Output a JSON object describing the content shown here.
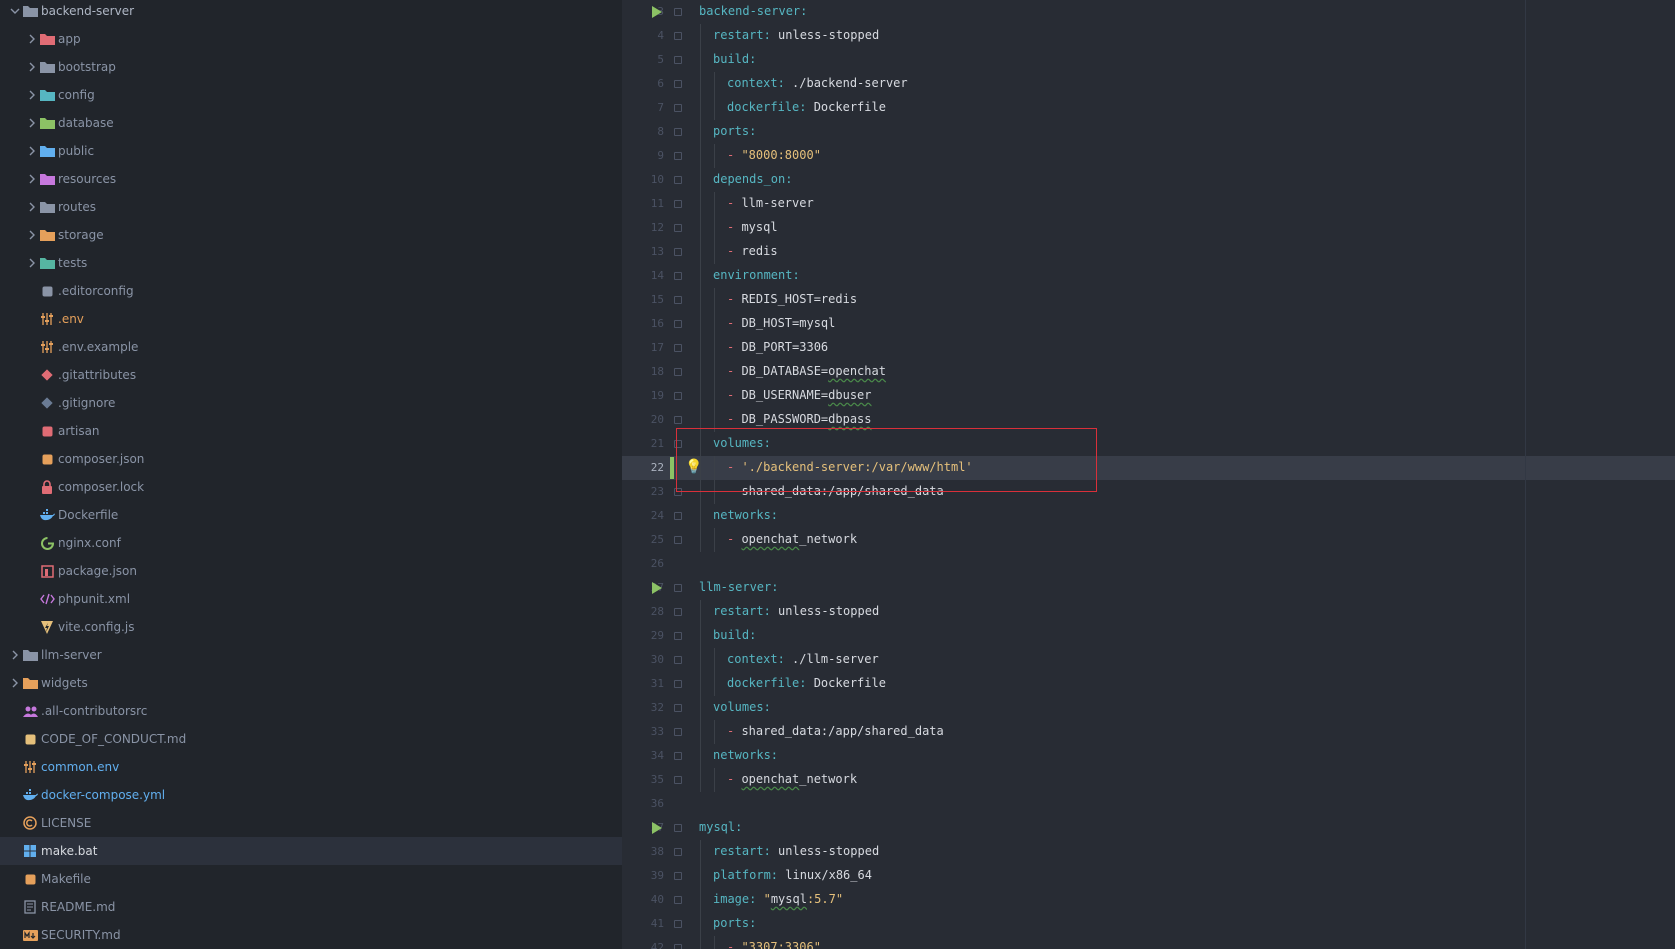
{
  "project_tree": {
    "items": [
      {
        "label": "backend-server",
        "depth": 0,
        "expanded": true,
        "icon": "folder-icon",
        "color": "#8a94a6",
        "style": "hl"
      },
      {
        "label": "app",
        "depth": 1,
        "expanded": false,
        "icon": "folder-app-icon",
        "color": "#e06c75"
      },
      {
        "label": "bootstrap",
        "depth": 1,
        "expanded": false,
        "icon": "folder-icon",
        "color": "#8a94a6"
      },
      {
        "label": "config",
        "depth": 1,
        "expanded": false,
        "icon": "folder-config-icon",
        "color": "#56b6c2"
      },
      {
        "label": "database",
        "depth": 1,
        "expanded": false,
        "icon": "folder-database-icon",
        "color": "#8cc265"
      },
      {
        "label": "public",
        "depth": 1,
        "expanded": false,
        "icon": "folder-public-icon",
        "color": "#61afef"
      },
      {
        "label": "resources",
        "depth": 1,
        "expanded": false,
        "icon": "folder-resources-icon",
        "color": "#c678dd"
      },
      {
        "label": "routes",
        "depth": 1,
        "expanded": false,
        "icon": "folder-routes-icon",
        "color": "#8a94a6"
      },
      {
        "label": "storage",
        "depth": 1,
        "expanded": false,
        "icon": "folder-storage-icon",
        "color": "#e5a05b"
      },
      {
        "label": "tests",
        "depth": 1,
        "expanded": false,
        "icon": "folder-tests-icon",
        "color": "#56b6a2"
      },
      {
        "label": ".editorconfig",
        "depth": 1,
        "icon": "editorconfig-icon",
        "color": "#8a94a6"
      },
      {
        "label": ".env",
        "depth": 1,
        "icon": "env-icon",
        "color": "#e5a05b",
        "style": "env"
      },
      {
        "label": ".env.example",
        "depth": 1,
        "icon": "env-icon",
        "color": "#e5a05b"
      },
      {
        "label": ".gitattributes",
        "depth": 1,
        "icon": "git-icon",
        "color": "#e06c75"
      },
      {
        "label": ".gitignore",
        "depth": 1,
        "icon": "git-icon",
        "color": "#6a7b94"
      },
      {
        "label": "artisan",
        "depth": 1,
        "icon": "laravel-icon",
        "color": "#e06c75"
      },
      {
        "label": "composer.json",
        "depth": 1,
        "icon": "composer-icon",
        "color": "#e5a05b"
      },
      {
        "label": "composer.lock",
        "depth": 1,
        "icon": "lock-icon",
        "color": "#e06c75"
      },
      {
        "label": "Dockerfile",
        "depth": 1,
        "icon": "docker-icon",
        "color": "#61afef"
      },
      {
        "label": "nginx.conf",
        "depth": 1,
        "icon": "nginx-icon",
        "color": "#8cc265"
      },
      {
        "label": "package.json",
        "depth": 1,
        "icon": "npm-icon",
        "color": "#e06c75"
      },
      {
        "label": "phpunit.xml",
        "depth": 1,
        "icon": "xml-icon",
        "color": "#c678dd"
      },
      {
        "label": "vite.config.js",
        "depth": 1,
        "icon": "vite-icon",
        "color": "#e5c07b"
      },
      {
        "label": "llm-server",
        "depth": 0,
        "expanded": false,
        "icon": "folder-icon",
        "color": "#8a94a6"
      },
      {
        "label": "widgets",
        "depth": 0,
        "expanded": false,
        "icon": "folder-widgets-icon",
        "color": "#e5a05b"
      },
      {
        "label": ".all-contributorsrc",
        "depth": 0,
        "icon": "contributors-icon",
        "color": "#c678dd"
      },
      {
        "label": "CODE_OF_CONDUCT.md",
        "depth": 0,
        "icon": "conduct-icon",
        "color": "#e5c07b"
      },
      {
        "label": "common.env",
        "depth": 0,
        "icon": "env-icon",
        "color": "#e5a05b",
        "style": "mod"
      },
      {
        "label": "docker-compose.yml",
        "depth": 0,
        "icon": "docker-icon",
        "color": "#61afef",
        "style": "mod"
      },
      {
        "label": "LICENSE",
        "depth": 0,
        "icon": "license-icon",
        "color": "#e5a05b"
      },
      {
        "label": "make.bat",
        "depth": 0,
        "icon": "windows-icon",
        "color": "#61afef",
        "style": "cur",
        "selected": true
      },
      {
        "label": "Makefile",
        "depth": 0,
        "icon": "makefile-icon",
        "color": "#e5a05b"
      },
      {
        "label": "README.md",
        "depth": 0,
        "icon": "readme-icon",
        "color": "#8a94a6"
      },
      {
        "label": "SECURITY.md",
        "depth": 0,
        "icon": "markdown-icon",
        "color": "#e5a05b"
      }
    ]
  },
  "editor": {
    "active_line": 22,
    "lines": [
      {
        "n": "3",
        "indent": 0,
        "run": true,
        "t": [
          [
            "backend-server",
            "k"
          ],
          [
            ":",
            "k"
          ]
        ]
      },
      {
        "n": "4",
        "indent": 1,
        "t": [
          [
            "restart",
            "k"
          ],
          [
            ": ",
            "k"
          ],
          [
            "unless-stopped",
            ""
          ]
        ]
      },
      {
        "n": "5",
        "indent": 1,
        "t": [
          [
            "build",
            "k"
          ],
          [
            ":",
            "k"
          ]
        ]
      },
      {
        "n": "6",
        "indent": 2,
        "t": [
          [
            "context",
            "k"
          ],
          [
            ": ",
            "k"
          ],
          [
            "./backend-server",
            ""
          ]
        ]
      },
      {
        "n": "7",
        "indent": 2,
        "t": [
          [
            "dockerfile",
            "k"
          ],
          [
            ": ",
            "k"
          ],
          [
            "Dockerfile",
            ""
          ]
        ]
      },
      {
        "n": "8",
        "indent": 1,
        "t": [
          [
            "ports",
            "k"
          ],
          [
            ":",
            "k"
          ]
        ]
      },
      {
        "n": "9",
        "indent": 2,
        "t": [
          [
            "- ",
            "d"
          ],
          [
            "\"8000:8000\"",
            "s2"
          ]
        ]
      },
      {
        "n": "10",
        "indent": 1,
        "t": [
          [
            "depends_on",
            "k"
          ],
          [
            ":",
            "k"
          ]
        ]
      },
      {
        "n": "11",
        "indent": 2,
        "t": [
          [
            "- ",
            "d"
          ],
          [
            "llm-server",
            ""
          ]
        ]
      },
      {
        "n": "12",
        "indent": 2,
        "t": [
          [
            "- ",
            "d"
          ],
          [
            "mysql",
            ""
          ]
        ]
      },
      {
        "n": "13",
        "indent": 2,
        "t": [
          [
            "- ",
            "d"
          ],
          [
            "redis",
            ""
          ]
        ]
      },
      {
        "n": "14",
        "indent": 1,
        "t": [
          [
            "environment",
            "k"
          ],
          [
            ":",
            "k"
          ]
        ]
      },
      {
        "n": "15",
        "indent": 2,
        "t": [
          [
            "- ",
            "d"
          ],
          [
            "REDIS_HOST=redis",
            ""
          ]
        ]
      },
      {
        "n": "16",
        "indent": 2,
        "t": [
          [
            "- ",
            "d"
          ],
          [
            "DB_HOST=mysql",
            ""
          ]
        ]
      },
      {
        "n": "17",
        "indent": 2,
        "t": [
          [
            "- ",
            "d"
          ],
          [
            "DB_PORT=3306",
            ""
          ]
        ]
      },
      {
        "n": "18",
        "indent": 2,
        "t": [
          [
            "- ",
            "d"
          ],
          [
            "DB_DATABASE=",
            ""
          ],
          [
            "openchat",
            "sq"
          ]
        ]
      },
      {
        "n": "19",
        "indent": 2,
        "t": [
          [
            "- ",
            "d"
          ],
          [
            "DB_USERNAME=",
            ""
          ],
          [
            "dbuser",
            "sq"
          ]
        ]
      },
      {
        "n": "20",
        "indent": 2,
        "t": [
          [
            "- ",
            "d"
          ],
          [
            "DB_PASSWORD=",
            ""
          ],
          [
            "dbpass",
            "sq"
          ]
        ]
      },
      {
        "n": "21",
        "indent": 1,
        "t": [
          [
            "volumes",
            "k"
          ],
          [
            ":",
            "k"
          ]
        ]
      },
      {
        "n": "22",
        "indent": 2,
        "active": true,
        "bulb": true,
        "mark": true,
        "t": [
          [
            "- ",
            "d"
          ],
          [
            "'./backend-server:/var/www/html'",
            "s2"
          ]
        ]
      },
      {
        "n": "23",
        "indent": 2,
        "t": [
          [
            "- ",
            "d"
          ],
          [
            "shared_data:/app/shared_data",
            ""
          ]
        ]
      },
      {
        "n": "24",
        "indent": 1,
        "t": [
          [
            "networks",
            "k"
          ],
          [
            ":",
            "k"
          ]
        ]
      },
      {
        "n": "25",
        "indent": 2,
        "t": [
          [
            "- ",
            "d"
          ],
          [
            "openchat",
            "sq"
          ],
          [
            "_network",
            ""
          ]
        ]
      },
      {
        "n": "26",
        "indent": 0,
        "t": []
      },
      {
        "n": "27",
        "indent": 0,
        "run": true,
        "t": [
          [
            "llm-server",
            "k"
          ],
          [
            ":",
            "k"
          ]
        ]
      },
      {
        "n": "28",
        "indent": 1,
        "t": [
          [
            "restart",
            "k"
          ],
          [
            ": ",
            "k"
          ],
          [
            "unless-stopped",
            ""
          ]
        ]
      },
      {
        "n": "29",
        "indent": 1,
        "t": [
          [
            "build",
            "k"
          ],
          [
            ":",
            "k"
          ]
        ]
      },
      {
        "n": "30",
        "indent": 2,
        "t": [
          [
            "context",
            "k"
          ],
          [
            ": ",
            "k"
          ],
          [
            "./llm-server",
            ""
          ]
        ]
      },
      {
        "n": "31",
        "indent": 2,
        "t": [
          [
            "dockerfile",
            "k"
          ],
          [
            ": ",
            "k"
          ],
          [
            "Dockerfile",
            ""
          ]
        ]
      },
      {
        "n": "32",
        "indent": 1,
        "t": [
          [
            "volumes",
            "k"
          ],
          [
            ":",
            "k"
          ]
        ]
      },
      {
        "n": "33",
        "indent": 2,
        "t": [
          [
            "- ",
            "d"
          ],
          [
            "shared_data:/app/shared_data",
            ""
          ]
        ]
      },
      {
        "n": "34",
        "indent": 1,
        "t": [
          [
            "networks",
            "k"
          ],
          [
            ":",
            "k"
          ]
        ]
      },
      {
        "n": "35",
        "indent": 2,
        "t": [
          [
            "- ",
            "d"
          ],
          [
            "openchat",
            "sq"
          ],
          [
            "_network",
            ""
          ]
        ]
      },
      {
        "n": "36",
        "indent": 0,
        "t": []
      },
      {
        "n": "37",
        "indent": 0,
        "run": true,
        "t": [
          [
            "mysql",
            "k"
          ],
          [
            ":",
            "k"
          ]
        ]
      },
      {
        "n": "38",
        "indent": 1,
        "t": [
          [
            "restart",
            "k"
          ],
          [
            ": ",
            "k"
          ],
          [
            "unless-stopped",
            ""
          ]
        ]
      },
      {
        "n": "39",
        "indent": 1,
        "t": [
          [
            "platform",
            "k"
          ],
          [
            ": ",
            "k"
          ],
          [
            "linux/x86_64",
            ""
          ]
        ]
      },
      {
        "n": "40",
        "indent": 1,
        "t": [
          [
            "image",
            "k"
          ],
          [
            ": ",
            "k"
          ],
          [
            "\"",
            "s2"
          ],
          [
            "mysql",
            "sq"
          ],
          [
            ":5.7\"",
            "s2"
          ]
        ]
      },
      {
        "n": "41",
        "indent": 1,
        "t": [
          [
            "ports",
            "k"
          ],
          [
            ":",
            "k"
          ]
        ]
      },
      {
        "n": "42",
        "indent": 2,
        "t": [
          [
            "- ",
            "d"
          ],
          [
            "\"3307:3306\"",
            "s2"
          ]
        ]
      }
    ]
  }
}
